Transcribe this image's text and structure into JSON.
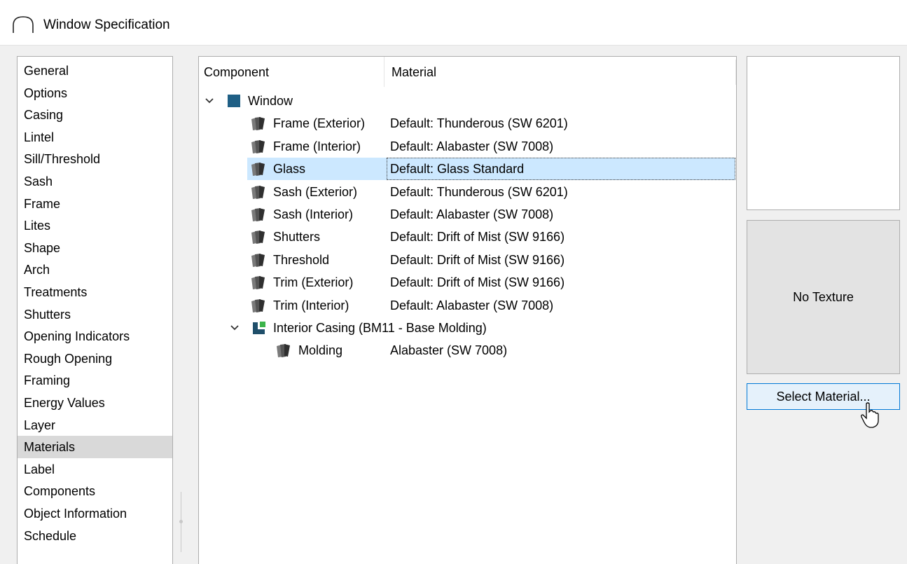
{
  "window": {
    "title": "Window Specification"
  },
  "categories": [
    {
      "label": "General"
    },
    {
      "label": "Options"
    },
    {
      "label": "Casing"
    },
    {
      "label": "Lintel"
    },
    {
      "label": "Sill/Threshold"
    },
    {
      "label": "Sash"
    },
    {
      "label": "Frame"
    },
    {
      "label": "Lites"
    },
    {
      "label": "Shape"
    },
    {
      "label": "Arch"
    },
    {
      "label": "Treatments"
    },
    {
      "label": "Shutters"
    },
    {
      "label": "Opening Indicators"
    },
    {
      "label": "Rough Opening"
    },
    {
      "label": "Framing"
    },
    {
      "label": "Energy Values"
    },
    {
      "label": "Layer"
    },
    {
      "label": "Materials",
      "selected": true
    },
    {
      "label": "Label"
    },
    {
      "label": "Components"
    },
    {
      "label": "Object Information"
    },
    {
      "label": "Schedule"
    }
  ],
  "materials_tree": {
    "columns": {
      "component": "Component",
      "material": "Material"
    },
    "rows": [
      {
        "component": "Window",
        "material": "",
        "level": 0,
        "type": "group",
        "expanded": true,
        "icon": "window-icon"
      },
      {
        "component": "Frame (Exterior)",
        "material": "Default: Thunderous (SW 6201)",
        "level": 1,
        "icon": "material-swatch-icon"
      },
      {
        "component": "Frame (Interior)",
        "material": "Default: Alabaster (SW 7008)",
        "level": 1,
        "icon": "material-swatch-icon"
      },
      {
        "component": "Glass",
        "material": "Default: Glass  Standard",
        "level": 1,
        "icon": "material-swatch-icon",
        "selected": true
      },
      {
        "component": "Sash (Exterior)",
        "material": "Default: Thunderous (SW 6201)",
        "level": 1,
        "icon": "material-swatch-icon"
      },
      {
        "component": "Sash (Interior)",
        "material": "Default: Alabaster (SW 7008)",
        "level": 1,
        "icon": "material-swatch-icon"
      },
      {
        "component": "Shutters",
        "material": "Default: Drift of Mist (SW 9166)",
        "level": 1,
        "icon": "material-swatch-icon"
      },
      {
        "component": "Threshold",
        "material": "Default: Drift of Mist (SW 9166)",
        "level": 1,
        "icon": "material-swatch-icon"
      },
      {
        "component": "Trim (Exterior)",
        "material": "Default: Drift of Mist (SW 9166)",
        "level": 1,
        "icon": "material-swatch-icon"
      },
      {
        "component": "Trim (Interior)",
        "material": "Default: Alabaster (SW 7008)",
        "level": 1,
        "icon": "material-swatch-icon"
      },
      {
        "component": "Interior Casing (BM11 - Base Molding)",
        "material": "",
        "level": 1,
        "type": "group",
        "expanded": true,
        "icon": "molding-group-icon"
      },
      {
        "component": "Molding",
        "material": "Alabaster (SW 7008)",
        "level": 2,
        "icon": "material-swatch-icon"
      }
    ]
  },
  "preview": {
    "no_texture_label": "No Texture",
    "select_material_button": "Select Material..."
  },
  "colors": {
    "window_icon": "#1f5f85",
    "group_icon_dark": "#1f4f6a",
    "group_icon_green": "#3cb44b",
    "selection": "#cce8ff",
    "button_border": "#0078d7"
  }
}
